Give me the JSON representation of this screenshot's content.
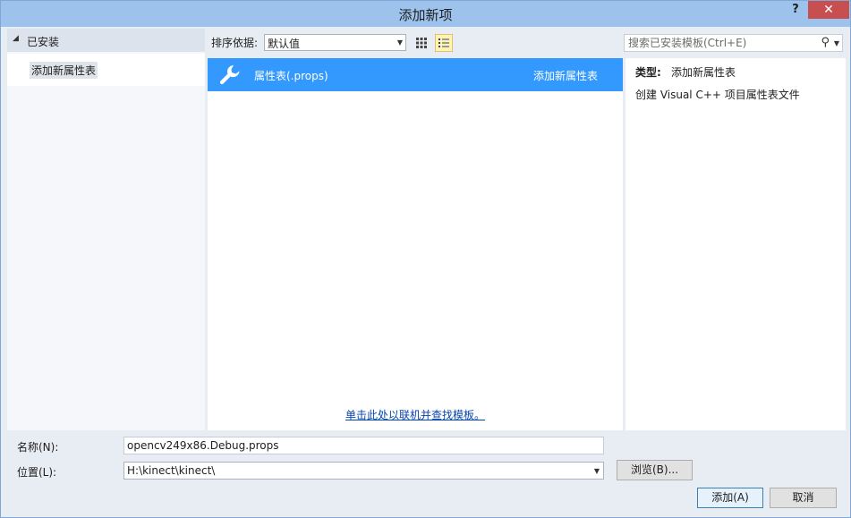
{
  "window": {
    "title": "添加新项",
    "help_label": "?",
    "close_label": "✕"
  },
  "left_tree": {
    "header": "已安装",
    "items": [
      {
        "label": "添加新属性表"
      }
    ]
  },
  "sort": {
    "label": "排序依据:",
    "value": "默认值"
  },
  "search": {
    "placeholder": "搜索已安装模板(Ctrl+E)"
  },
  "templates": [
    {
      "name": "属性表(.props)",
      "type": "添加新属性表",
      "icon": "wrench-icon",
      "selected": true
    }
  ],
  "online_link": "单击此处以联机并查找模板。",
  "details": {
    "type_label": "类型:",
    "type_value": "添加新属性表",
    "description": "创建 Visual C++ 项目属性表文件"
  },
  "form": {
    "name_label": "名称(N):",
    "name_value": "opencv249x86.Debug.props",
    "location_label": "位置(L):",
    "location_value": "H:\\kinect\\kinect\\"
  },
  "buttons": {
    "browse": "浏览(B)...",
    "add": "添加(A)",
    "cancel": "取消"
  },
  "colors": {
    "titlebar": "#9dc3ec",
    "selection": "#3399ff",
    "link": "#0645ad",
    "close": "#c74f4f"
  }
}
